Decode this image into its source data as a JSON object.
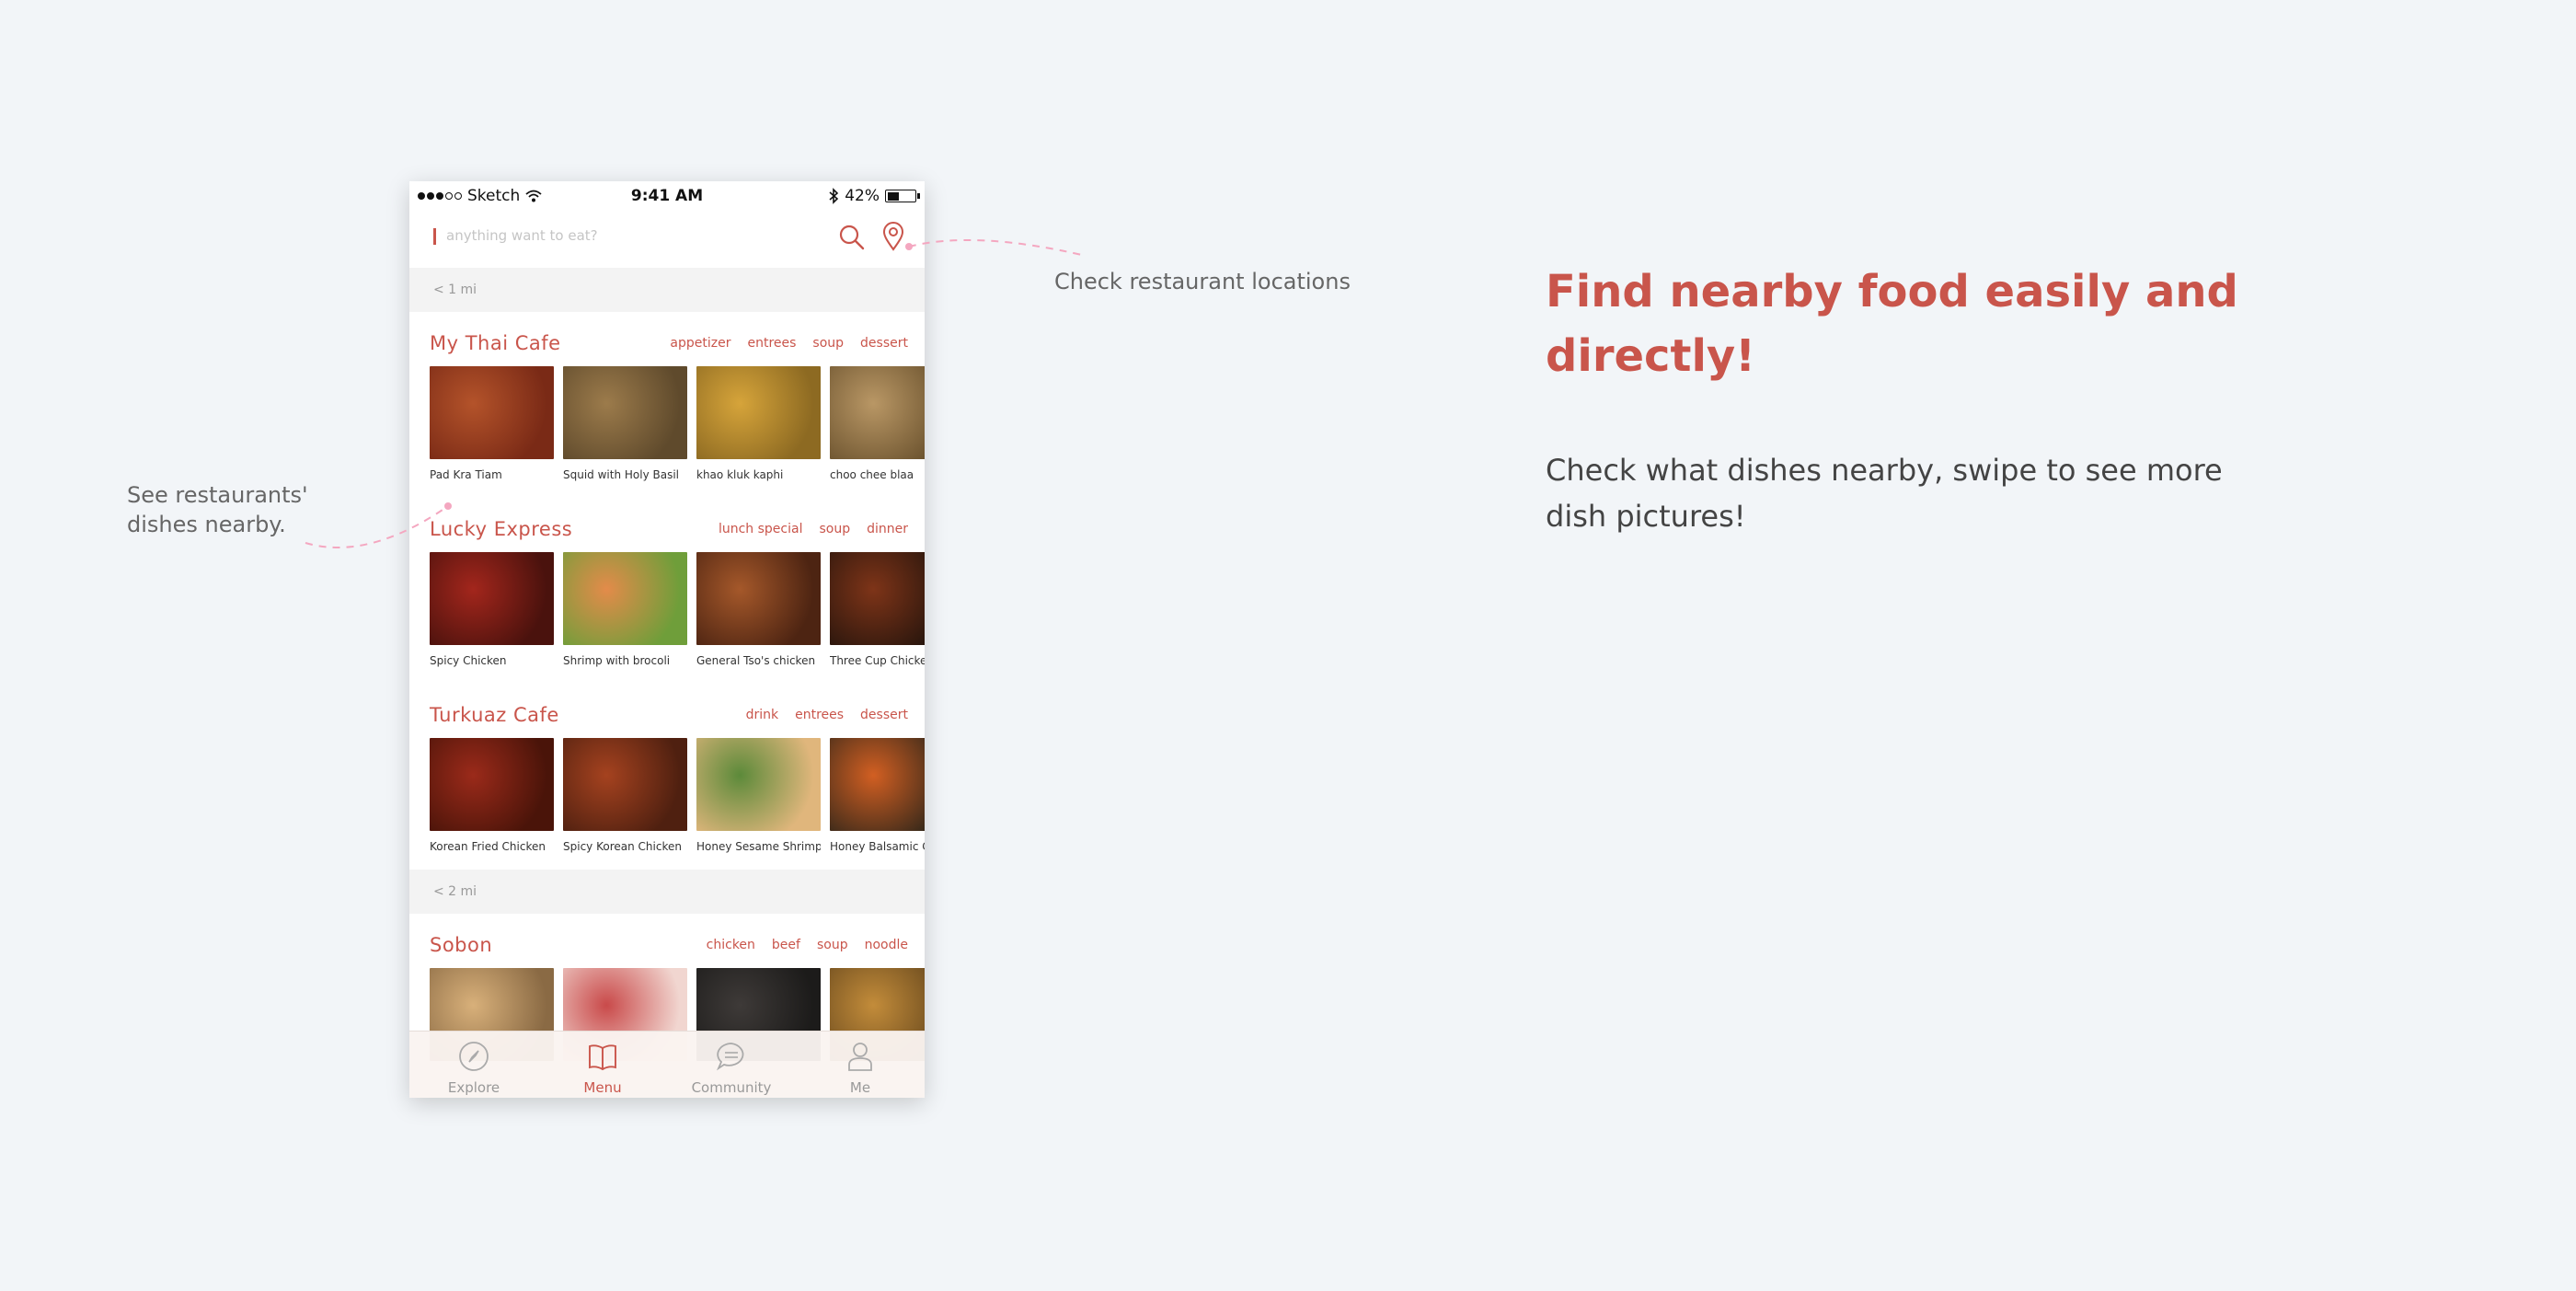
{
  "statusbar": {
    "carrier": "Sketch",
    "time": "9:41 AM",
    "battery": "42%",
    "battery_level": 0.42
  },
  "search": {
    "placeholder": "anything want to eat?"
  },
  "sections": [
    {
      "distance": "< 1 mi",
      "restaurants": [
        {
          "name": "My Thai Cafe",
          "tags": [
            "appetizer",
            "entrees",
            "soup",
            "dessert"
          ],
          "dishes": [
            {
              "name": "Pad Kra Tiam",
              "colors": [
                "#b4532a",
                "#7a2a16"
              ]
            },
            {
              "name": "Squid with Holy Basil",
              "colors": [
                "#9c7b4b",
                "#5f4a2c"
              ]
            },
            {
              "name": "khao kluk kaphi",
              "colors": [
                "#d6a43a",
                "#8d6a22"
              ]
            },
            {
              "name": "choo chee blaa",
              "colors": [
                "#b99765",
                "#6e5530"
              ]
            }
          ]
        },
        {
          "name": "Lucky Express",
          "tags": [
            "lunch special",
            "soup",
            "dinner"
          ],
          "dishes": [
            {
              "name": "Spicy Chicken",
              "colors": [
                "#a3261c",
                "#4a120d"
              ]
            },
            {
              "name": "Shrimp with brocoli",
              "colors": [
                "#e38b4a",
                "#6f9e3a"
              ]
            },
            {
              "name": "General Tso's chicken",
              "colors": [
                "#a5582a",
                "#4d2412"
              ]
            },
            {
              "name": "Three Cup Chicken",
              "colors": [
                "#7e3418",
                "#2a160d"
              ]
            }
          ]
        },
        {
          "name": "Turkuaz Cafe",
          "tags": [
            "drink",
            "entrees",
            "dessert"
          ],
          "dishes": [
            {
              "name": "Korean Fried Chicken",
              "colors": [
                "#9b2a1a",
                "#4a1409"
              ]
            },
            {
              "name": "Spicy Korean Chicken",
              "colors": [
                "#a5421f",
                "#4f2010"
              ]
            },
            {
              "name": "Honey Sesame Shrimp",
              "colors": [
                "#5c8a3a",
                "#e0b67c"
              ]
            },
            {
              "name": "Honey Balsamic Carrots",
              "colors": [
                "#d25f22",
                "#3b2a1a"
              ]
            }
          ]
        }
      ]
    },
    {
      "distance": "< 2 mi",
      "restaurants": [
        {
          "name": "Sobon",
          "tags": [
            "chicken",
            "beef",
            "soup",
            "noodle"
          ],
          "dishes": [
            {
              "name": "",
              "colors": [
                "#d8b07a",
                "#8a6a44"
              ]
            },
            {
              "name": "",
              "colors": [
                "#c94a4a",
                "#f1d6d0"
              ]
            },
            {
              "name": "",
              "colors": [
                "#3e3a38",
                "#1c1b1a"
              ]
            },
            {
              "name": "",
              "colors": [
                "#c38c3a",
                "#6a4a1e"
              ]
            }
          ]
        }
      ]
    }
  ],
  "tabbar": [
    {
      "label": "Explore",
      "icon": "compass-icon",
      "active": false
    },
    {
      "label": "Menu",
      "icon": "book-icon",
      "active": true
    },
    {
      "label": "Community",
      "icon": "chat-icon",
      "active": false
    },
    {
      "label": "Me",
      "icon": "person-icon",
      "active": false
    }
  ],
  "annotations": {
    "locations": "Check restaurant locations",
    "nearby_line1": "See restaurants'",
    "nearby_line2": "dishes nearby."
  },
  "headline": "Find nearby food easily and directly!",
  "description": "Check what dishes nearby, swipe to see more dish pictures!",
  "colors": {
    "accent": "#c9554b",
    "background": "#f2f5f8",
    "annotation_line": "#f4a7c0"
  }
}
